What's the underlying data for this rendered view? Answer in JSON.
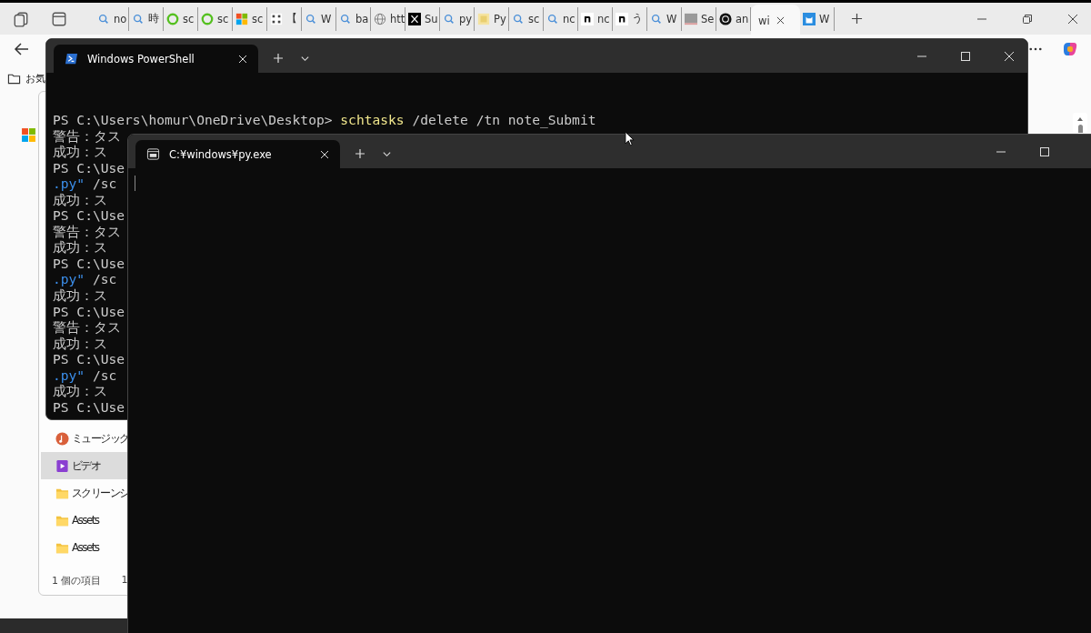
{
  "browser": {
    "tabs": [
      {
        "title": "no",
        "kind": "search",
        "selected": false
      },
      {
        "title": "時",
        "kind": "search",
        "selected": false
      },
      {
        "title": "sc",
        "kind": "ring",
        "selected": false
      },
      {
        "title": "sc",
        "kind": "ring",
        "selected": false
      },
      {
        "title": "sc",
        "kind": "windows",
        "selected": false
      },
      {
        "title": "【",
        "kind": "grid",
        "selected": false
      },
      {
        "title": "W",
        "kind": "search",
        "selected": false
      },
      {
        "title": "ba",
        "kind": "search",
        "selected": false
      },
      {
        "title": "htt",
        "kind": "globe",
        "selected": false
      },
      {
        "title": "Su",
        "kind": "cross",
        "selected": false
      },
      {
        "title": "py",
        "kind": "search",
        "selected": false
      },
      {
        "title": "Py",
        "kind": "doc",
        "selected": false
      },
      {
        "title": "sc",
        "kind": "search",
        "selected": false
      },
      {
        "title": "nc",
        "kind": "search",
        "selected": false
      },
      {
        "title": "nc",
        "kind": "arch",
        "selected": false
      },
      {
        "title": "う",
        "kind": "arch",
        "selected": false
      },
      {
        "title": "W",
        "kind": "search",
        "selected": false
      },
      {
        "title": "Se",
        "kind": "swatch",
        "selected": false
      },
      {
        "title": "an",
        "kind": "knot",
        "selected": false
      },
      {
        "title": "wi",
        "kind": "plain",
        "selected": true
      },
      {
        "title": "W",
        "kind": "cat",
        "selected": false
      }
    ],
    "favorites_label": "お気"
  },
  "explorer": {
    "items": [
      {
        "label": "ミュージック",
        "kind": "music",
        "selected": false
      },
      {
        "label": "ビデオ",
        "kind": "video",
        "selected": true
      },
      {
        "label": "スクリーンシ",
        "kind": "folder",
        "selected": false
      },
      {
        "label": "Assets",
        "kind": "folder",
        "selected": false
      },
      {
        "label": "Assets",
        "kind": "folder",
        "selected": false
      }
    ],
    "status": [
      "1 個の項目",
      "1"
    ]
  },
  "powershell": {
    "title": "Windows PowerShell",
    "lines": [
      {
        "prompt": "PS C:\\Users\\homur\\OneDrive\\Desktop> ",
        "command": "schtasks",
        "args": " /delete /tn note_Submit"
      },
      {
        "text": "警告：タス"
      },
      {
        "text": "成功：ス"
      },
      {
        "text": "PS C:\\Use"
      },
      {
        "string": ".py\"",
        "text": " /sc"
      },
      {
        "text": "成功：ス"
      },
      {
        "text": "PS C:\\Use"
      },
      {
        "text": "警告：タス"
      },
      {
        "text": "成功：ス"
      },
      {
        "text": "PS C:\\Use"
      },
      {
        "string": ".py\"",
        "text": " /sc"
      },
      {
        "text": "成功：ス"
      },
      {
        "text": "PS C:\\Use"
      },
      {
        "text": "警告：タス"
      },
      {
        "text": "成功：ス"
      },
      {
        "text": "PS C:\\Use"
      },
      {
        "string": ".py\"",
        "text": " /sc"
      },
      {
        "text": "成功：ス"
      },
      {
        "text": "PS C:\\Use"
      }
    ]
  },
  "console": {
    "title": "C:¥windows¥py.exe"
  }
}
